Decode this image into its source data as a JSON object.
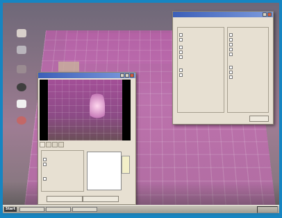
{
  "desktop": {
    "icons": [
      "app-icon",
      "app-icon",
      "app-icon",
      "globe-icon",
      "document-icon",
      "recycle-icon"
    ]
  },
  "capture_window": {
    "title": "",
    "tabs": [
      "",
      "",
      "",
      ""
    ],
    "list_items": [
      "",
      "",
      "",
      "",
      "",
      "",
      ""
    ],
    "button_left": "",
    "button_right": ""
  },
  "settings_window": {
    "title": "",
    "left_group_label": "",
    "right_group_label": "",
    "checkboxes_left": [
      "",
      "",
      "",
      "",
      "",
      "",
      "",
      ""
    ],
    "checkboxes_right": [
      "",
      "",
      "",
      "",
      "",
      "",
      "",
      "",
      ""
    ],
    "ok_button": "",
    "cancel_button": ""
  },
  "taskbar": {
    "start_label": "Start",
    "tasks": [
      "",
      "",
      ""
    ],
    "clock": ""
  },
  "colors": {
    "frame": "#1685c2",
    "grid_purple": "#b35fa4",
    "titlebar": "#3c5fb8"
  }
}
